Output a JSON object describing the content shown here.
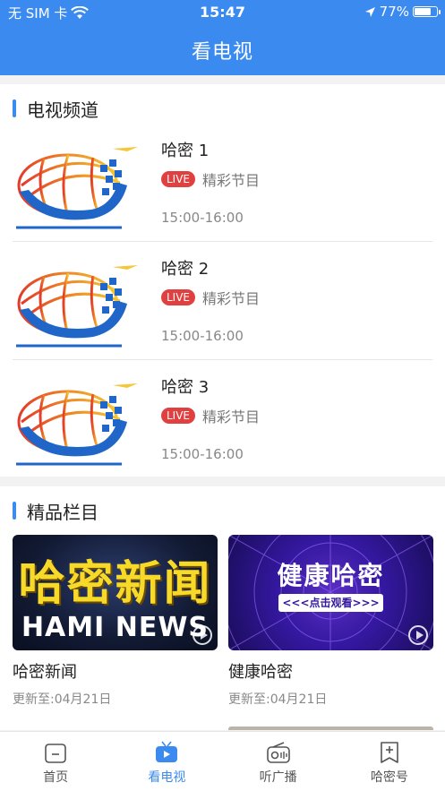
{
  "status_bar": {
    "carrier": "无 SIM 卡",
    "time": "15:47",
    "battery": "77%",
    "battery_level": 0.77
  },
  "header": {
    "title": "看电视"
  },
  "tv_channels": {
    "title": "电视频道",
    "items": [
      {
        "name": "哈密 1",
        "badge": "LIVE",
        "program": "精彩节目",
        "time": "15:00-16:00"
      },
      {
        "name": "哈密 2",
        "badge": "LIVE",
        "program": "精彩节目",
        "time": "15:00-16:00"
      },
      {
        "name": "哈密 3",
        "badge": "LIVE",
        "program": "精彩节目",
        "time": "15:00-16:00"
      }
    ]
  },
  "featured": {
    "title": "精品栏目",
    "items": [
      {
        "title": "哈密新闻",
        "updated": "更新至:04月21日",
        "thumb_text": "哈密新闻",
        "thumb_sub": "HAMI NEWS"
      },
      {
        "title": "健康哈密",
        "updated": "更新至:04月21日",
        "thumb_text": "健康哈密",
        "thumb_sub": "<<<点击观看>>>"
      }
    ]
  },
  "tabbar": {
    "items": [
      {
        "label": "首页",
        "icon": "home-icon"
      },
      {
        "label": "看电视",
        "icon": "tv-icon"
      },
      {
        "label": "听广播",
        "icon": "radio-icon"
      },
      {
        "label": "哈密号",
        "icon": "hami-account-icon"
      }
    ],
    "active_index": 1
  },
  "colors": {
    "accent": "#3a8af0",
    "live": "#e0403f"
  }
}
